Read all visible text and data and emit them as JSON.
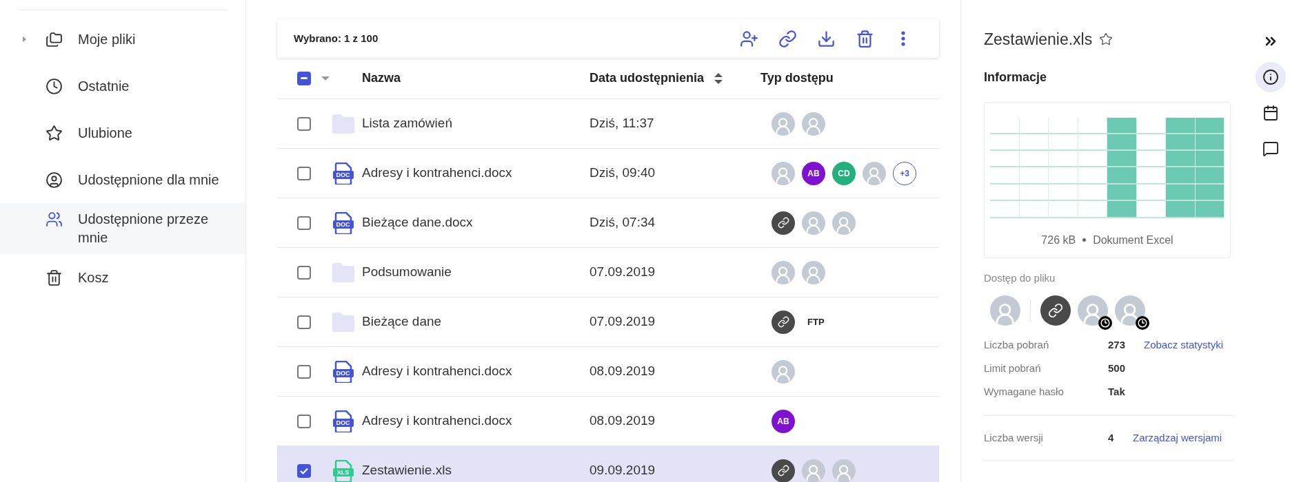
{
  "sidebar": {
    "items": [
      {
        "label": "Moje pliki",
        "selected": false,
        "expanded": false
      },
      {
        "label": "Ostatnie",
        "selected": false
      },
      {
        "label": "Ulubione",
        "selected": false
      },
      {
        "label": "Udostępnione dla mnie",
        "selected": false
      },
      {
        "label": "Udostępnione przeze mnie",
        "selected": true
      },
      {
        "label": "Kosz",
        "selected": false
      }
    ]
  },
  "toolbar": {
    "selection": "Wybrano: 1 z 100"
  },
  "table": {
    "select_all": {
      "indeterminate": true
    },
    "columns": [
      "Nazwa",
      "Data udostępnienia",
      "Typ dostępu"
    ],
    "rows": [
      {
        "kind": "folder",
        "name": "Lista zamówień",
        "date": "Dziś, 11:37",
        "selected": false,
        "access": [
          {
            "kind": "photo"
          },
          {
            "kind": "photo"
          }
        ]
      },
      {
        "kind": "doc",
        "icon_label": "DOC",
        "name": "Adresy i kontrahenci.docx",
        "date": "Dziś, 09:40",
        "selected": false,
        "access": [
          {
            "kind": "photo"
          },
          {
            "kind": "initials",
            "text": "AB",
            "color": "#7e12d0"
          },
          {
            "kind": "initials",
            "text": "CD",
            "color": "#22b07d"
          },
          {
            "kind": "photo"
          },
          {
            "kind": "more",
            "text": "+3"
          }
        ]
      },
      {
        "kind": "doc",
        "icon_label": "DOC",
        "name": "Bieżące dane.docx",
        "date": "Dziś, 07:34",
        "selected": false,
        "access": [
          {
            "kind": "link"
          },
          {
            "kind": "photo"
          },
          {
            "kind": "photo"
          }
        ]
      },
      {
        "kind": "folder",
        "name": "Podsumowanie",
        "date": "07.09.2019",
        "selected": false,
        "access": [
          {
            "kind": "photo"
          },
          {
            "kind": "photo"
          }
        ]
      },
      {
        "kind": "folder",
        "name": "Bieżące dane",
        "date": "07.09.2019",
        "selected": false,
        "access": [
          {
            "kind": "link"
          },
          {
            "kind": "label",
            "text": "FTP"
          }
        ]
      },
      {
        "kind": "doc",
        "icon_label": "DOC",
        "name": "Adresy i kontrahenci.docx",
        "date": "08.09.2019",
        "selected": false,
        "access": [
          {
            "kind": "photo"
          }
        ]
      },
      {
        "kind": "doc",
        "icon_label": "DOC",
        "name": "Adresy i kontrahenci.docx",
        "date": "08.09.2019",
        "selected": false,
        "access": [
          {
            "kind": "initials",
            "text": "AB",
            "color": "#7e12d0"
          }
        ]
      },
      {
        "kind": "xls",
        "icon_label": "XLS",
        "name": "Zestawienie.xls",
        "date": "09.09.2019",
        "selected": true,
        "access": [
          {
            "kind": "link"
          },
          {
            "kind": "photo"
          },
          {
            "kind": "photo"
          }
        ]
      }
    ]
  },
  "details": {
    "title": "Zestawienie.xls",
    "favorite": false,
    "section": "Informacje",
    "preview": {
      "size": "726 kB",
      "type": "Dokument Excel"
    },
    "access_label": "Dostęp do pliku",
    "access": [
      {
        "kind": "photo",
        "timed": false
      },
      {
        "kind": "separator"
      },
      {
        "kind": "link",
        "timed": false
      },
      {
        "kind": "photo",
        "timed": true
      },
      {
        "kind": "photo",
        "timed": true
      }
    ],
    "stats": [
      {
        "label": "Liczba pobrań",
        "value": "273",
        "link": "Zobacz statystyki"
      },
      {
        "label": "Limit pobrań",
        "value": "500"
      },
      {
        "label": "Wymagane hasło",
        "value": "Tak"
      }
    ],
    "versions": {
      "label": "Liczba wersji",
      "value": "4",
      "link": "Zarządzaj wersjami"
    }
  },
  "side_tabs": [
    {
      "selected": false
    },
    {
      "selected": true
    },
    {
      "selected": false
    },
    {
      "selected": false
    }
  ]
}
